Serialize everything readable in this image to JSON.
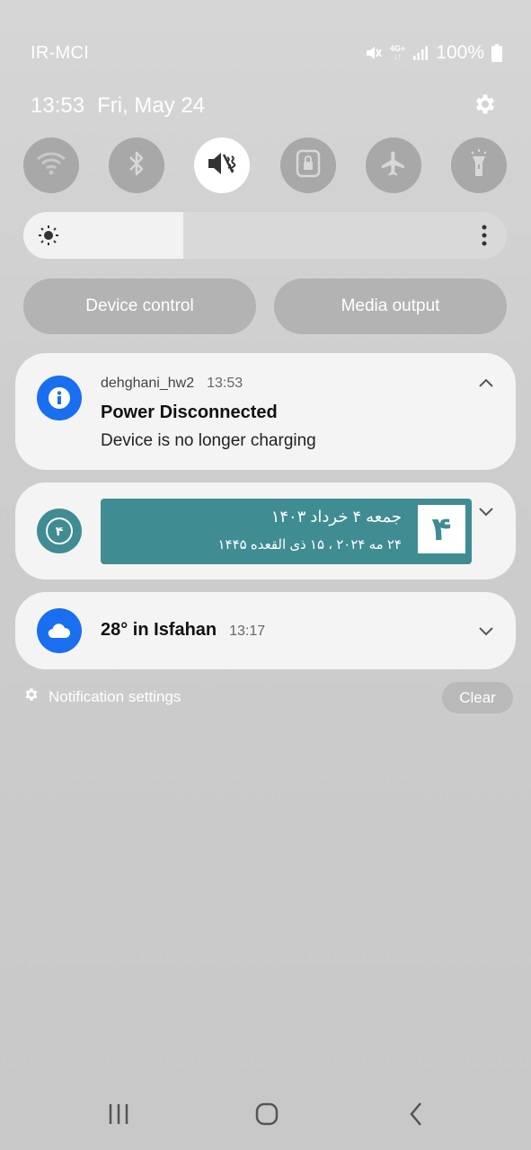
{
  "status_bar": {
    "carrier": "IR-MCI",
    "network_type": "4G+",
    "battery": "100%",
    "icons": [
      "mute-icon",
      "network-4g-icon",
      "signal-icon",
      "battery-icon"
    ]
  },
  "header": {
    "time": "13:53",
    "date": "Fri, May 24",
    "settings_icon": "gear-icon"
  },
  "quick_tiles": [
    {
      "name": "wifi",
      "icon": "wifi-icon",
      "active": false
    },
    {
      "name": "bluetooth",
      "icon": "bluetooth-icon",
      "active": false
    },
    {
      "name": "sound-mute",
      "icon": "mute-icon",
      "active": true
    },
    {
      "name": "lock-screen",
      "icon": "lock-icon",
      "active": false
    },
    {
      "name": "airplane",
      "icon": "airplane-icon",
      "active": false
    },
    {
      "name": "flashlight",
      "icon": "flashlight-icon",
      "active": false
    }
  ],
  "brightness": {
    "level": 0.33,
    "icon": "sun-icon",
    "more_icon": "more-vertical-icon"
  },
  "buttons": {
    "device_control": "Device control",
    "media_output": "Media output"
  },
  "notifications": [
    {
      "app": "dehghani_hw2",
      "time": "13:53",
      "title": "Power Disconnected",
      "body": "Device is no longer charging",
      "icon": "info-icon",
      "icon_color": "#1a6ef0",
      "expanded": true
    },
    {
      "app_icon_text": "۴",
      "icon_color": "#3f8c93",
      "banner_day": "۴",
      "banner_line1": "جمعه ۴ خرداد ۱۴۰۳",
      "banner_line2": "۲۴ مه ۲۰۲۴  ،  ۱۵ ذی القعده ۱۴۴۵",
      "expanded": false
    },
    {
      "title": "28° in Isfahan",
      "time": "13:17",
      "icon": "cloud-icon",
      "icon_color": "#1a6ef0",
      "expanded": false
    }
  ],
  "footer": {
    "notification_settings": "Notification settings",
    "clear": "Clear"
  },
  "navbar": {
    "recents": "recents-icon",
    "home": "home-icon",
    "back": "back-icon"
  }
}
